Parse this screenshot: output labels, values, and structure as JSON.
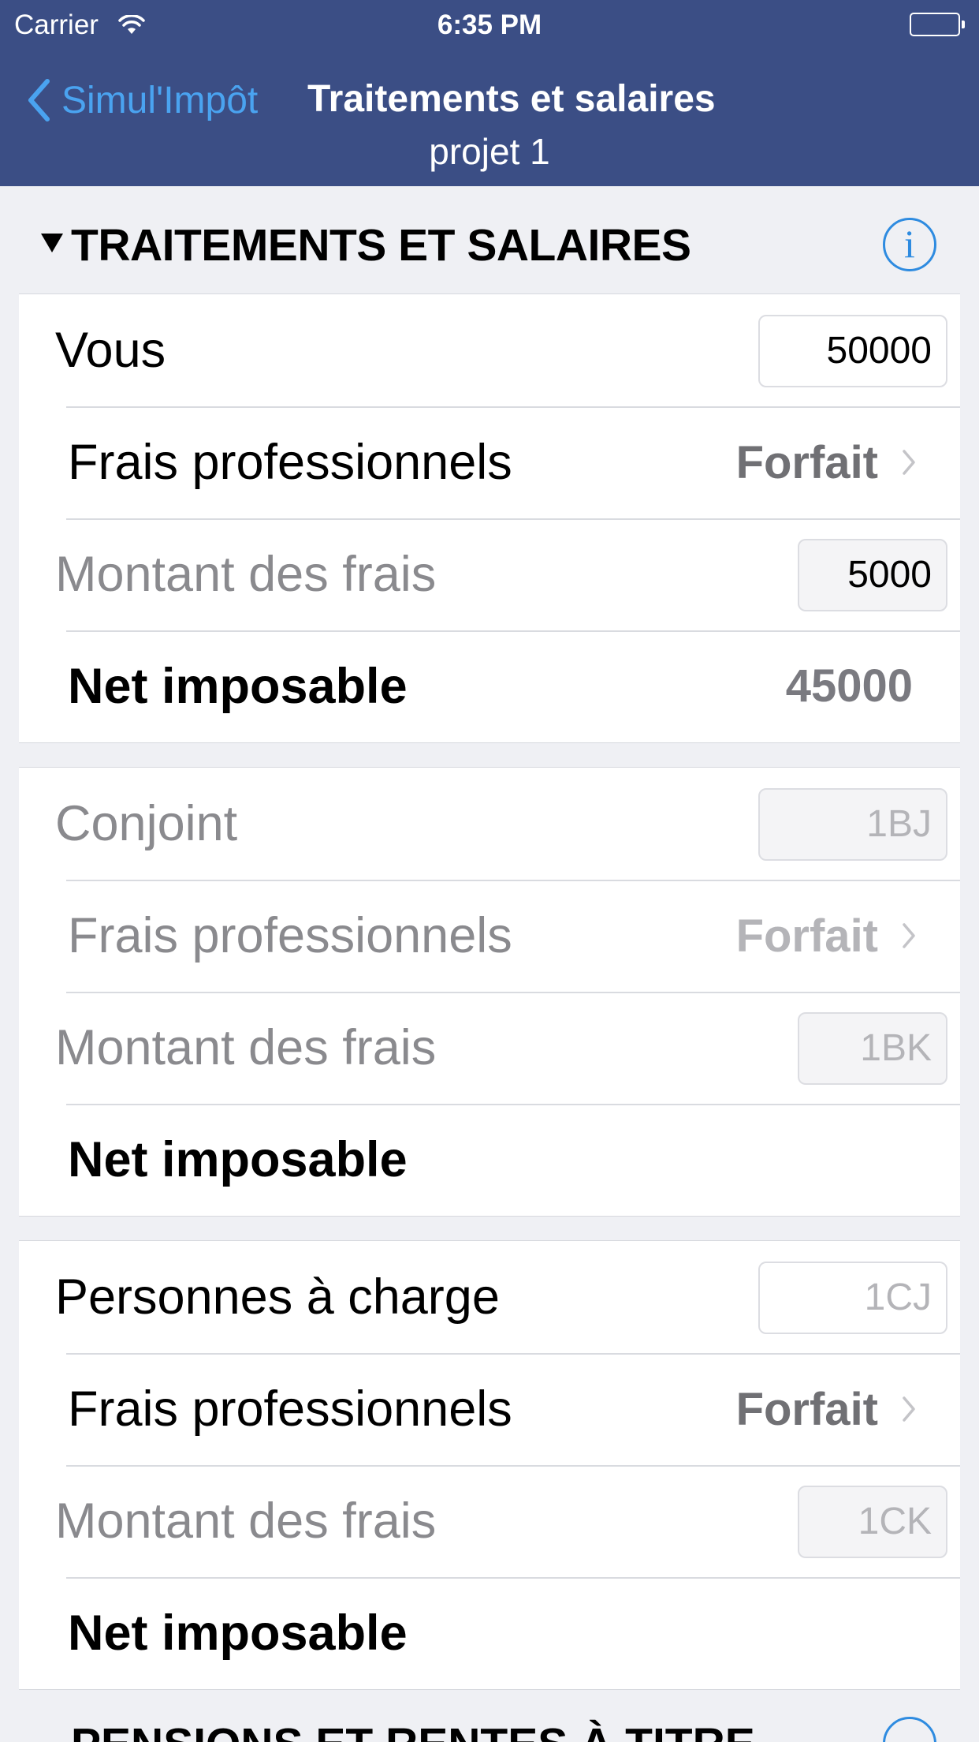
{
  "status_bar": {
    "carrier": "Carrier",
    "time": "6:35 PM"
  },
  "nav": {
    "back_label": "Simul'Impôt",
    "title": "Traitements et salaires",
    "subtitle": "projet 1"
  },
  "section": {
    "title": "TRAITEMENTS ET SALAIRES",
    "info_glyph": "i"
  },
  "vous": {
    "label": "Vous",
    "value": "50000",
    "frais_label": "Frais professionnels",
    "frais_mode": "Forfait",
    "montant_label": "Montant des frais",
    "montant_value": "5000",
    "net_label": "Net imposable",
    "net_value": "45000"
  },
  "conjoint": {
    "label": "Conjoint",
    "placeholder": "1BJ",
    "frais_label": "Frais professionnels",
    "frais_mode": "Forfait",
    "montant_label": "Montant des frais",
    "montant_placeholder": "1BK",
    "net_label": "Net imposable"
  },
  "personnes": {
    "label": "Personnes à charge",
    "placeholder": "1CJ",
    "frais_label": "Frais professionnels",
    "frais_mode": "Forfait",
    "montant_label": "Montant des frais",
    "montant_placeholder": "1CK",
    "net_label": "Net imposable"
  },
  "next_section": {
    "title": "PENSIONS ET RENTES À TITRE"
  },
  "colors": {
    "nav_background": "#3b4e85",
    "accent": "#2e8be0",
    "back_link": "#4aa3f0",
    "page_background": "#eff0f4"
  }
}
